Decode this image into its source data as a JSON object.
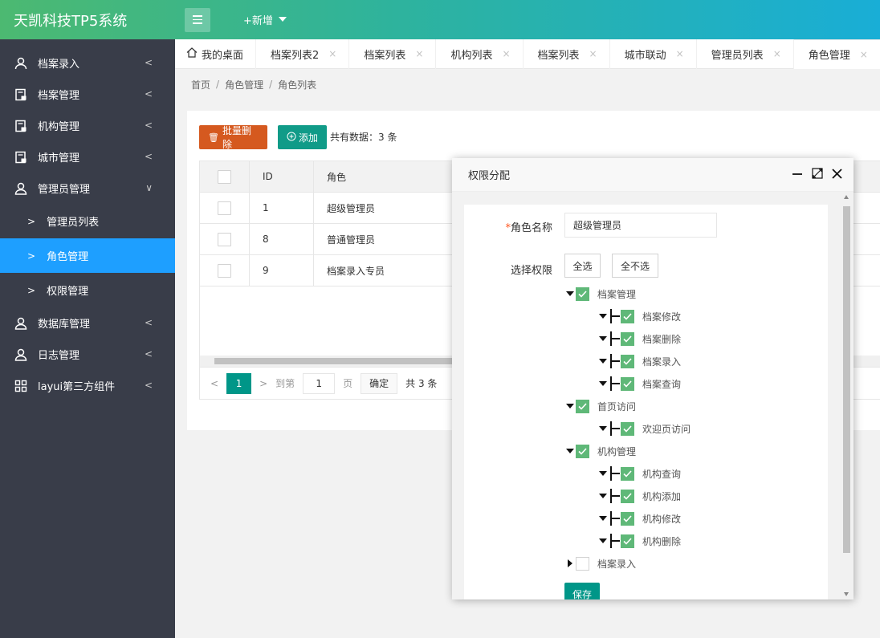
{
  "header": {
    "brand": "天凯科技TP5系统",
    "add_new": "+新增"
  },
  "sidebar": {
    "items": [
      {
        "label": "档案录入",
        "icon": "user-icon"
      },
      {
        "label": "档案管理",
        "icon": "doc-icon"
      },
      {
        "label": "机构管理",
        "icon": "doc-icon"
      },
      {
        "label": "城市管理",
        "icon": "doc-icon"
      },
      {
        "label": "管理员管理",
        "icon": "users-icon"
      }
    ],
    "sub_items": [
      {
        "label": "管理员列表"
      },
      {
        "label": "角色管理"
      },
      {
        "label": "权限管理"
      }
    ],
    "items2": [
      {
        "label": "数据库管理"
      },
      {
        "label": "日志管理"
      },
      {
        "label": "layui第三方组件"
      }
    ],
    "chev": ">",
    "arrow_left": "<",
    "arrow_down": "∨"
  },
  "tabs": [
    {
      "label": "我的桌面"
    },
    {
      "label": "档案列表2"
    },
    {
      "label": "档案列表"
    },
    {
      "label": "机构列表"
    },
    {
      "label": "档案列表"
    },
    {
      "label": "城市联动"
    },
    {
      "label": "管理员列表"
    },
    {
      "label": "角色管理"
    }
  ],
  "tab_close": "×",
  "breadcrumb": {
    "a": "首页",
    "b": "角色管理",
    "c": "角色列表",
    "sep": "/"
  },
  "toolbar": {
    "batch_delete": "批量删除",
    "add": "添加",
    "total": "共有数据：3 条"
  },
  "table": {
    "headers": {
      "id": "ID",
      "role": "角色"
    },
    "rows": [
      {
        "id": "1",
        "role": "超级管理员"
      },
      {
        "id": "8",
        "role": "普通管理员"
      },
      {
        "id": "9",
        "role": "档案录入专员"
      }
    ]
  },
  "pager": {
    "prev": "<",
    "page": "1",
    "next": ">",
    "goto": "到第",
    "input": "1",
    "unit": "页",
    "confirm": "确定",
    "total": "共 3 条"
  },
  "dialog": {
    "title": "权限分配",
    "role_name_label": "角色名称",
    "required_mark": "*",
    "role_name_value": "超级管理员",
    "select_label": "选择权限",
    "select_all": "全选",
    "select_none": "全不选",
    "save": "保存",
    "tree": {
      "archives": "档案管理",
      "archives_edit": "档案修改",
      "archives_delete": "档案删除",
      "archives_entry": "档案录入",
      "archives_query": "档案查询",
      "home": "首页访问",
      "home_welcome": "欢迎页访问",
      "org": "机构管理",
      "org_query": "机构查询",
      "org_add": "机构添加",
      "org_edit": "机构修改",
      "org_delete": "机构删除",
      "entry": "档案录入"
    }
  },
  "colors": {
    "primary": "#009688",
    "active": "#1e9fff",
    "sidebar": "#393d49",
    "danger": "#d5591f",
    "check": "#5fb878"
  }
}
